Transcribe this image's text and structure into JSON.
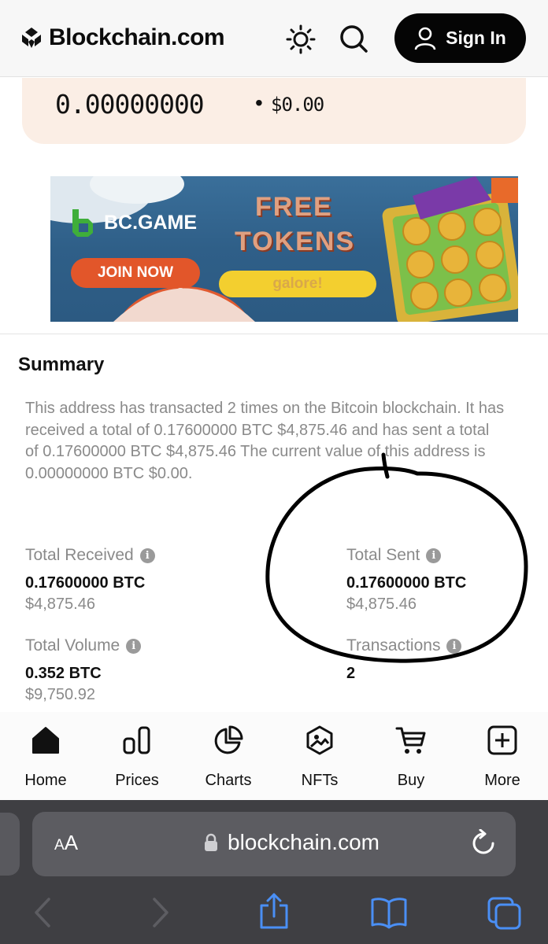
{
  "header": {
    "brand": "Blockchain.com",
    "signin_label": "Sign In"
  },
  "balance": {
    "btc": "0.00000000",
    "usd": "$0.00"
  },
  "ad": {
    "brand": "BC.GAME",
    "cta": "JOIN NOW",
    "headline_line1": "FREE",
    "headline_line2": "TOKENS",
    "tag": "galore!"
  },
  "summary": {
    "title": "Summary",
    "description": "This address has transacted 2 times on the Bitcoin blockchain. It has received a total of 0.17600000 BTC $4,875.46 and has sent a total of 0.17600000 BTC $4,875.46 The current value of this address is 0.00000000 BTC $0.00.",
    "stats": {
      "total_received": {
        "label": "Total Received",
        "value": "0.17600000 BTC",
        "usd": "$4,875.46"
      },
      "total_sent": {
        "label": "Total Sent",
        "value": "0.17600000 BTC",
        "usd": "$4,875.46"
      },
      "total_volume": {
        "label": "Total Volume",
        "value": "0.352 BTC",
        "usd": "$9,750.92"
      },
      "transactions": {
        "label": "Transactions",
        "value": "2"
      }
    }
  },
  "bottom_nav": {
    "items": [
      {
        "label": "Home",
        "icon": "home-icon"
      },
      {
        "label": "Prices",
        "icon": "bar-chart-icon"
      },
      {
        "label": "Charts",
        "icon": "pie-chart-icon"
      },
      {
        "label": "NFTs",
        "icon": "image-icon"
      },
      {
        "label": "Buy",
        "icon": "cart-icon"
      },
      {
        "label": "More",
        "icon": "plus-square-icon"
      }
    ]
  },
  "browser": {
    "aa_small": "A",
    "aa_large": "A",
    "url": "blockchain.com"
  },
  "colors": {
    "accent_dark": "#050505",
    "balance_card_bg": "#fbeee5",
    "annotation_ink": "#000000"
  }
}
